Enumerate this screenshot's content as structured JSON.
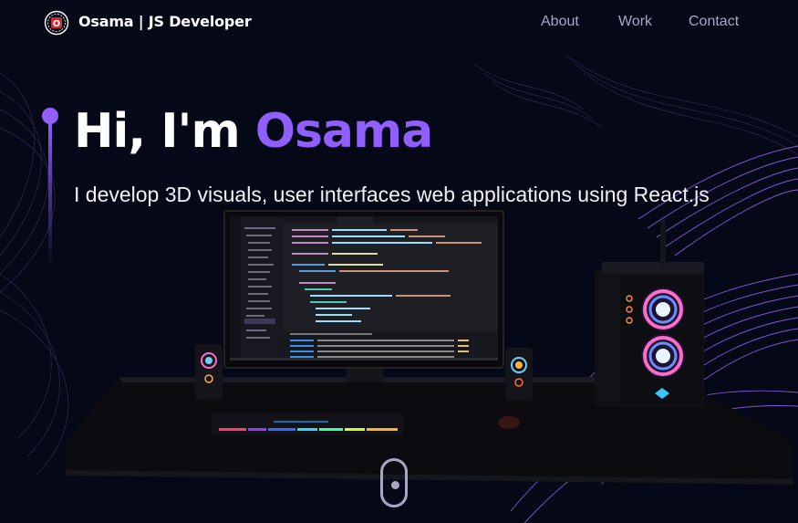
{
  "nav": {
    "brand": "Osama | JS Developer",
    "links": [
      "About",
      "Work",
      "Contact"
    ],
    "logo_icon": "osama-logo-icon"
  },
  "hero": {
    "greeting": "Hi, I'm ",
    "name": "Osama",
    "subtitle": "I develop 3D visuals, user interfaces web applications using React.js"
  },
  "colors": {
    "background": "#050816",
    "accent": "#915eff",
    "nav_text": "#aaa6c3"
  },
  "icons": [
    "osama-logo-icon",
    "mouse-scroll-icon"
  ]
}
